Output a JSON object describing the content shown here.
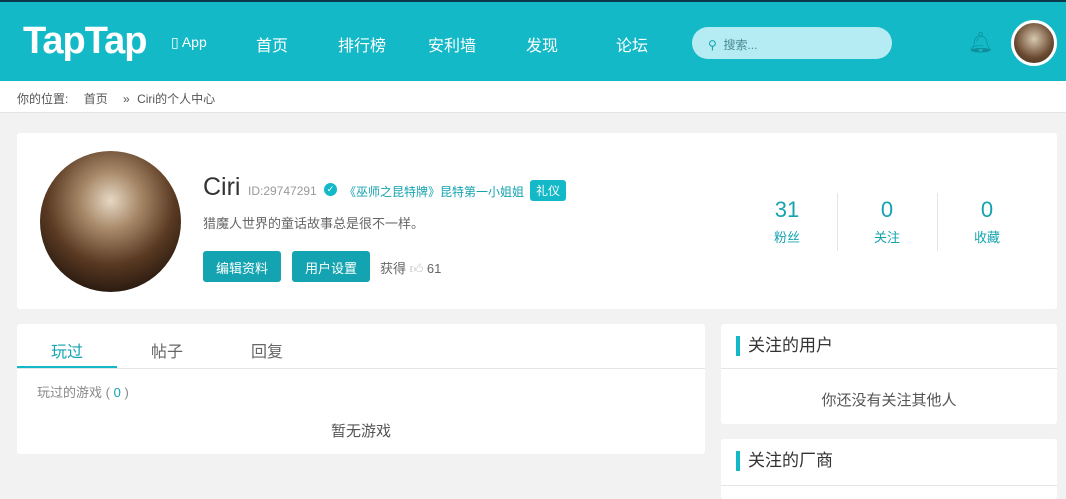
{
  "header": {
    "logo": "TapTap",
    "app": "App",
    "nav": [
      "首页",
      "排行榜",
      "安利墙",
      "发现",
      "论坛"
    ],
    "search_placeholder": "搜索..."
  },
  "breadcrumb": {
    "label": "你的位置:",
    "home": "首页",
    "sep": "»",
    "current": "Ciri的个人中心"
  },
  "profile": {
    "name": "Ciri",
    "id": "ID:29747291",
    "title": "《巫师之昆特牌》昆特第一小姐姐",
    "badge": "礼仪",
    "bio": "猎魔人世界的童话故事总是很不一样。",
    "edit": "编辑资料",
    "settings": "用户设置",
    "got": "获得",
    "likes": "61",
    "stats": [
      {
        "n": "31",
        "l": "粉丝"
      },
      {
        "n": "0",
        "l": "关注"
      },
      {
        "n": "0",
        "l": "收藏"
      }
    ]
  },
  "tabs": [
    "玩过",
    "帖子",
    "回复"
  ],
  "played": {
    "label": "玩过的游戏",
    "open": "(",
    "count": "0",
    "close": ")",
    "empty": "暂无游戏"
  },
  "following_users": {
    "title": "关注的用户",
    "empty": "你还没有关注其他人"
  },
  "following_vendors": {
    "title": "关注的厂商"
  }
}
